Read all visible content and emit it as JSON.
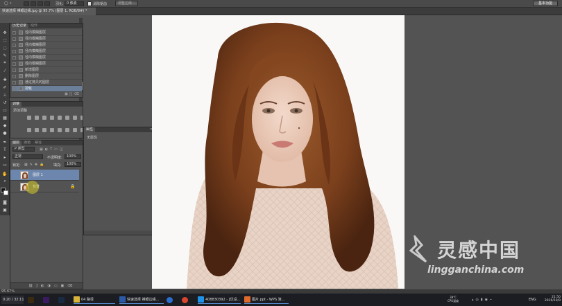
{
  "options_bar": {
    "feather_label": "羽化:",
    "feather_value": "0 像素",
    "antialias_label": "消除锯齿",
    "refine_label": "调整边缘...",
    "workspace": "基本功能"
  },
  "document_tab": {
    "title": "快速选择 裸眼边缘.jpg @ 95.7% (图层 1, RGB/8#) *"
  },
  "history_panel": {
    "tabs": [
      "历史记录",
      "动作"
    ],
    "items": [
      {
        "label": "径向模糊图层",
        "selected": false
      },
      {
        "label": "径向模糊图层",
        "selected": false
      },
      {
        "label": "径向模糊图层",
        "selected": false
      },
      {
        "label": "径向模糊图层",
        "selected": false
      },
      {
        "label": "径向模糊图层",
        "selected": false
      },
      {
        "label": "径向模糊图层",
        "selected": false
      },
      {
        "label": "新增图层",
        "selected": false
      },
      {
        "label": "删除图层",
        "selected": false
      },
      {
        "label": "通过拷贝的图层",
        "selected": false
      },
      {
        "label": "羽化",
        "selected": true
      }
    ]
  },
  "adjustments_panel": {
    "tab": "调整",
    "title": "添加调整"
  },
  "layers_panel": {
    "tabs": [
      "图层",
      "通道",
      "路径"
    ],
    "filter": "P 类型",
    "blend_mode": "正常",
    "opacity_label": "不透明度:",
    "opacity_value": "100%",
    "lock_label": "锁定:",
    "fill_label": "填充:",
    "fill_value": "100%",
    "layers": [
      {
        "name": "图层 1",
        "selected": true,
        "visible": true,
        "locked": false
      },
      {
        "name": "背景",
        "selected": false,
        "visible": true,
        "locked": true
      }
    ]
  },
  "properties_panel": {
    "tab": "属性",
    "content": "无属性"
  },
  "status_bar": {
    "zoom": "95.67%"
  },
  "taskbar": {
    "time_display": "0:20 / 32:11",
    "apps": [
      {
        "label": "04 路径",
        "color": "#d9b43a"
      },
      {
        "label": "快速选择 裸眼边缘...",
        "color": "#2a5aa8"
      },
      {
        "label": "408830392 - [优设...",
        "color": "#1d92e6"
      },
      {
        "label": "图片.ppt - WPS 演...",
        "color": "#e06a2c"
      }
    ],
    "tray": {
      "temp": "38°C",
      "cpu": "CPU温度",
      "lang": "ENG",
      "time": "21:50",
      "date": "2016/10/9"
    }
  },
  "watermark": {
    "name": "灵感中国",
    "url": "lingganchina.com"
  },
  "colors": {
    "accent_selection": "#6c86ad",
    "panel_bg": "#535353",
    "canvas_bg": "#faf8f7"
  }
}
